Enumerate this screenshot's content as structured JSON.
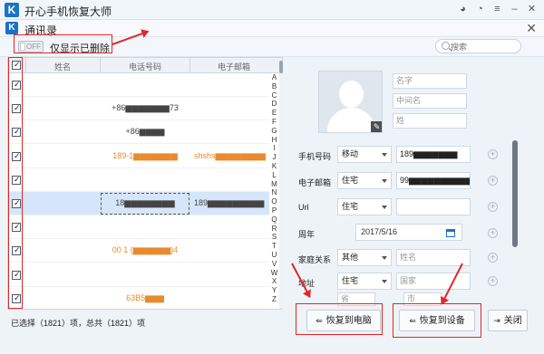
{
  "app": {
    "title": "开心手机恢复大师",
    "logo": "K"
  },
  "window_icons": [
    "wechat-icon",
    "chat-icon",
    "menu-icon",
    "minimize-icon",
    "close-icon"
  ],
  "dialog": {
    "title": "通讯录",
    "close": "✕"
  },
  "toolbar": {
    "toggle_state": "OFF",
    "toggle_label": "仅显示已删除",
    "search_placeholder": "搜索"
  },
  "list": {
    "columns": [
      "姓名",
      "电话号码",
      "电子邮箱"
    ],
    "alphabet": [
      "A",
      "B",
      "C",
      "D",
      "E",
      "F",
      "G",
      "H",
      "I",
      "J",
      "K",
      "L",
      "M",
      "N",
      "O",
      "P",
      "Q",
      "R",
      "S",
      "T",
      "U",
      "V",
      "W",
      "X",
      "Y",
      "Z"
    ],
    "rows": [
      {
        "checked": true,
        "phone": "",
        "email": "",
        "style": "dark"
      },
      {
        "checked": true,
        "phone": "+86▆▆▆▆▆▆▆73",
        "email": "",
        "style": "dark"
      },
      {
        "checked": true,
        "phone": "+86▆▆▆▆",
        "email": "",
        "style": "dark"
      },
      {
        "checked": true,
        "phone": "189-1▆▆▆▆▆▆▆",
        "email": "shshs▆▆▆▆▆▆▆▆",
        "style": "orange"
      },
      {
        "checked": true,
        "phone": "",
        "email": "",
        "style": "dark"
      },
      {
        "checked": true,
        "phone": "18▆▆▆▆▆▆▆▆",
        "email": "189▆▆▆▆▆▆▆▆▆",
        "style": "dark",
        "selected": true
      },
      {
        "checked": true,
        "phone": "",
        "email": "",
        "style": "dark"
      },
      {
        "checked": true,
        "phone": "00 1 (▆▆▆▆▆▆)4",
        "email": "",
        "style": "orange"
      },
      {
        "checked": true,
        "phone": "",
        "email": "",
        "style": "dark"
      },
      {
        "checked": true,
        "phone": "63B5▆▆▆",
        "email": "",
        "style": "orange"
      }
    ]
  },
  "status": "已选择（1821）项，总共（1821）项",
  "detail": {
    "name_placeholders": [
      "名字",
      "中间名",
      "姓"
    ],
    "phone": {
      "label": "手机号码",
      "type": "移动",
      "value": "189▆▆▆▆▆▆▆"
    },
    "email": {
      "label": "电子邮箱",
      "type": "住宅",
      "value": "99▆▆▆▆▆▆▆▆▆▆▆.cn"
    },
    "url": {
      "label": "Url",
      "type": "住宅",
      "value": ""
    },
    "anniversary": {
      "label": "周年",
      "value": "2017/5/16"
    },
    "family": {
      "label": "家庭关系",
      "type": "其他",
      "placeholder": "姓名"
    },
    "address": {
      "label": "地址",
      "type": "住宅",
      "placeholder": "国家",
      "extra": [
        "省",
        "市"
      ]
    },
    "plus_symbol": "+"
  },
  "buttons": {
    "restore_pc": "恢复到电脑",
    "restore_device": "恢复到设备",
    "close": "关闭"
  },
  "annotation_color": "#e32626",
  "accent_color": "#1a73c8"
}
